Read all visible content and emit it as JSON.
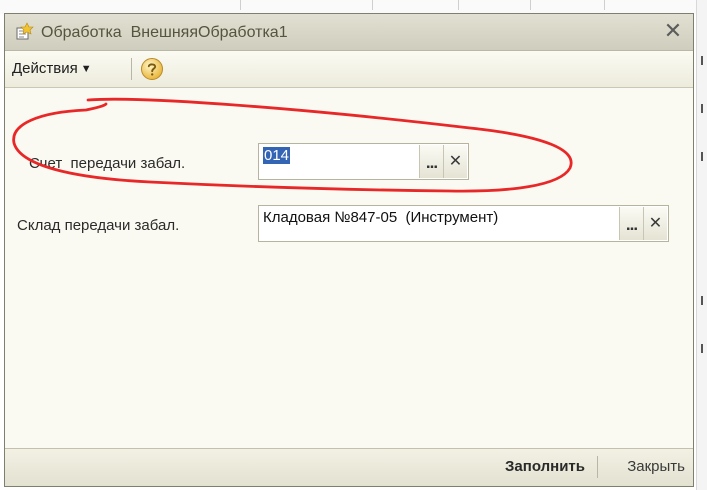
{
  "window": {
    "title": "Обработка  ВнешняяОбработка1",
    "close_glyph": "✕",
    "icon": "processing-icon"
  },
  "toolbar": {
    "actions_label": "Действия",
    "actions_caret": "▼",
    "help_icon": "help-icon"
  },
  "fields": [
    {
      "label": "Счет  передачи забал.",
      "value": "014",
      "selected": true,
      "choose_glyph": "...",
      "clear_glyph": "✕"
    },
    {
      "label": "Склад передачи забал.",
      "value": "Кладовая №847-05  (Инструмент)",
      "selected": false,
      "choose_glyph": "...",
      "clear_glyph": "✕"
    }
  ],
  "footer": {
    "fill_label": "Заполнить",
    "close_label": "Закрыть"
  },
  "colors": {
    "annotation": "#e82828",
    "selection": "#3465b4",
    "window_bg": "#fbfaf2"
  }
}
